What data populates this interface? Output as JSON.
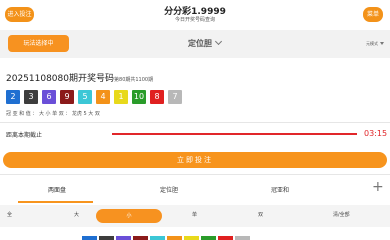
{
  "header": {
    "left_button": "进入投注",
    "title": "分分彩1.9999",
    "subtitle": "今日开奖号码查询",
    "right_button": "菜单"
  },
  "toolbar": {
    "left_button": "玩法选择中",
    "play_select": "定位胆",
    "right_label": "元模式"
  },
  "draw": {
    "issue": "20251108080",
    "issue_suffix": "期开奖号码",
    "issue_note": "第80期共1100期",
    "balls": [
      {
        "value": "2",
        "color": "#1f6fd1"
      },
      {
        "value": "3",
        "color": "#3d3d3d"
      },
      {
        "value": "6",
        "color": "#6a4fd8"
      },
      {
        "value": "9",
        "color": "#8b1a1a"
      },
      {
        "value": "5",
        "color": "#3cc7d6"
      },
      {
        "value": "4",
        "color": "#f39219"
      },
      {
        "value": "1",
        "color": "#e8d91b"
      },
      {
        "value": "10",
        "color": "#2a9c2a"
      },
      {
        "value": "8",
        "color": "#e02020"
      },
      {
        "value": "7",
        "color": "#b8b8b8"
      }
    ],
    "stats": "冠 亚 和 值 ： 大 小 单 双 ：  龙虎  5  大  双"
  },
  "countdown": {
    "label": "距离本期截止",
    "time": "03:15"
  },
  "bet_button": "立即投注",
  "tabs": [
    "两面盘",
    "定位胆",
    "冠亚和"
  ],
  "filters": [
    "全",
    "大",
    "小",
    "单",
    "双",
    "清/全部"
  ],
  "colors": {
    "accent": "#f7941d",
    "timer": "#e1262a"
  }
}
